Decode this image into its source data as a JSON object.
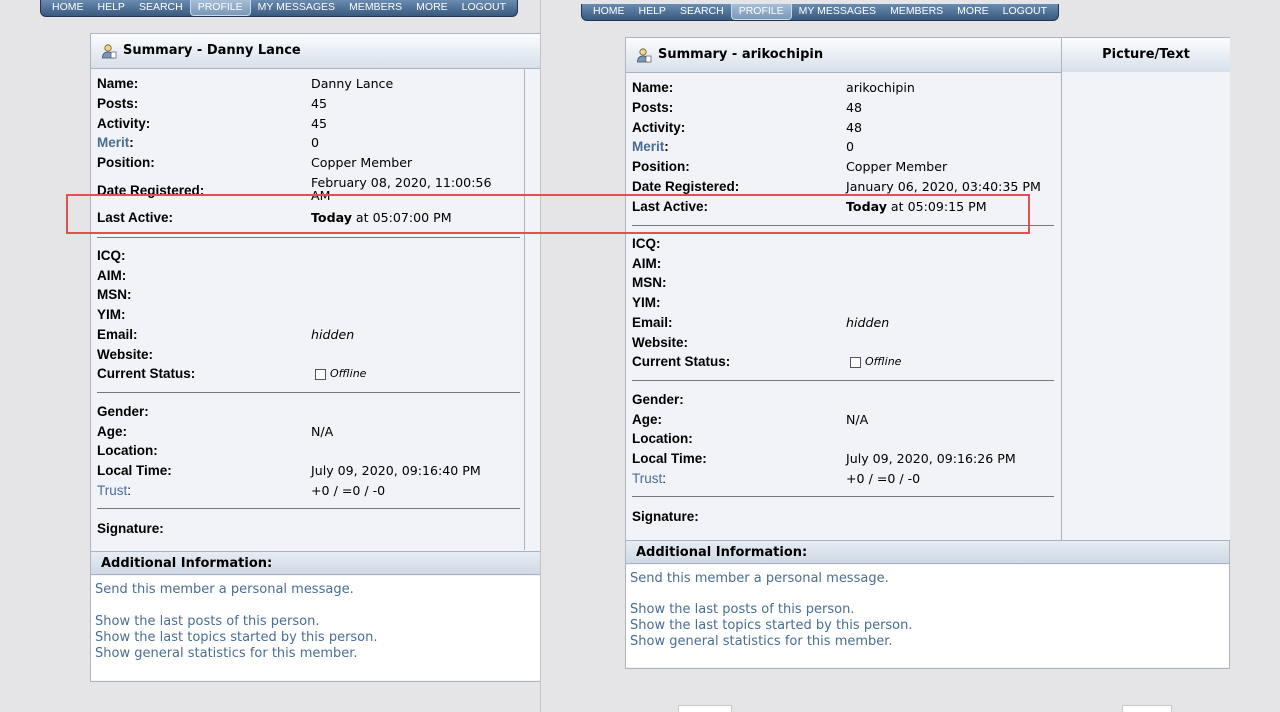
{
  "nav": {
    "items": [
      "HOME",
      "HELP",
      "SEARCH",
      "PROFILE",
      "MY MESSAGES",
      "MEMBERS",
      "MORE",
      "LOGOUT"
    ],
    "active": "PROFILE"
  },
  "left": {
    "summary_title": "Summary - Danny Lance",
    "rows": {
      "name": {
        "label": "Name:",
        "value": "Danny Lance"
      },
      "posts": {
        "label": "Posts:",
        "value": "45"
      },
      "activity": {
        "label": "Activity:",
        "value": "45"
      },
      "merit": {
        "label": "Merit",
        "colon": ":",
        "value": "0"
      },
      "position": {
        "label": "Position:",
        "value": "Copper Member"
      },
      "date_registered": {
        "label": "Date Registered:",
        "value_line1": "February 08, 2020, 11:00:56",
        "value_line2": "AM"
      },
      "last_active": {
        "label": "Last Active:",
        "value_bold": "Today",
        "value_rest": " at 05:07:00 PM"
      },
      "icq": {
        "label": "ICQ:"
      },
      "aim": {
        "label": "AIM:"
      },
      "msn": {
        "label": "MSN:"
      },
      "yim": {
        "label": "YIM:"
      },
      "email": {
        "label": "Email:",
        "value": "hidden"
      },
      "website": {
        "label": "Website:"
      },
      "status": {
        "label": "Current Status:",
        "value": "Offline"
      },
      "gender": {
        "label": "Gender:"
      },
      "age": {
        "label": "Age:",
        "value": "N/A"
      },
      "location": {
        "label": "Location:"
      },
      "local_time": {
        "label": "Local Time:",
        "value": "July 09, 2020, 09:16:40 PM"
      },
      "trust": {
        "label": "Trust",
        "colon": ":",
        "value": "+0 / =0 / -0"
      },
      "signature": {
        "label": "Signature:"
      }
    },
    "additional": {
      "title": "Additional Information:",
      "links": [
        "Send this member a personal message.",
        "Show the last posts of this person.",
        "Show the last topics started by this person.",
        "Show general statistics for this member."
      ]
    }
  },
  "right": {
    "summary_title": "Summary - arikochipin",
    "picture_header": "Picture/Text",
    "rows": {
      "name": {
        "label": "Name:",
        "value": "arikochipin"
      },
      "posts": {
        "label": "Posts:",
        "value": "48"
      },
      "activity": {
        "label": "Activity:",
        "value": "48"
      },
      "merit": {
        "label": "Merit",
        "colon": ":",
        "value": "0"
      },
      "position": {
        "label": "Position:",
        "value": "Copper Member"
      },
      "date_registered": {
        "label": "Date Registered:",
        "value": "January 06, 2020, 03:40:35 PM"
      },
      "last_active": {
        "label": "Last Active:",
        "value_bold": "Today",
        "value_rest": " at 05:09:15 PM"
      },
      "icq": {
        "label": "ICQ:"
      },
      "aim": {
        "label": "AIM:"
      },
      "msn": {
        "label": "MSN:"
      },
      "yim": {
        "label": "YIM:"
      },
      "email": {
        "label": "Email:",
        "value": "hidden"
      },
      "website": {
        "label": "Website:"
      },
      "status": {
        "label": "Current Status:",
        "value": "Offline"
      },
      "gender": {
        "label": "Gender:"
      },
      "age": {
        "label": "Age:",
        "value": "N/A"
      },
      "location": {
        "label": "Location:"
      },
      "local_time": {
        "label": "Local Time:",
        "value": "July 09, 2020, 09:16:26 PM"
      },
      "trust": {
        "label": "Trust",
        "colon": ":",
        "value": "+0 / =0 / -0"
      },
      "signature": {
        "label": "Signature:"
      }
    },
    "additional": {
      "title": "Additional Information:",
      "links": [
        "Send this member a personal message.",
        "Show the last posts of this person.",
        "Show the last topics started by this person.",
        "Show general statistics for this member."
      ]
    }
  },
  "colors": {
    "link": "#4a6d94",
    "highlight": "#e05252",
    "nav_bg": "#39597e"
  }
}
